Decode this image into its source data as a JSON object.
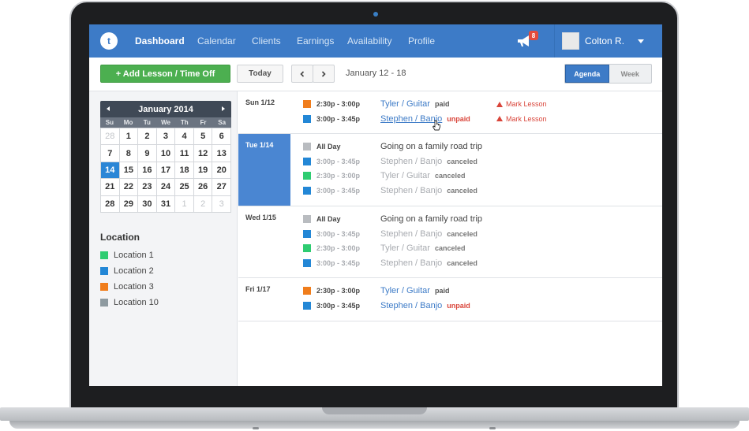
{
  "nav": {
    "logo": "t",
    "items": [
      "Dashboard",
      "Calendar",
      "Clients",
      "Earnings",
      "Availability",
      "Profile"
    ],
    "notification_count": "8",
    "user_name": "Colton R."
  },
  "toolbar": {
    "add_label": "+ Add Lesson / Time Off",
    "today_label": "Today",
    "range_label": "January 12 - 18",
    "view_agenda": "Agenda",
    "view_week": "Week"
  },
  "calendar": {
    "title": "January 2014",
    "dow": [
      "Su",
      "Mo",
      "Tu",
      "We",
      "Th",
      "Fr",
      "Sa"
    ],
    "days": [
      "28",
      "1",
      "2",
      "3",
      "4",
      "5",
      "6",
      "7",
      "8",
      "9",
      "10",
      "11",
      "12",
      "13",
      "12",
      "13",
      "14",
      "15",
      "16",
      "17",
      "18",
      "19",
      "20",
      "21",
      "22",
      "23",
      "24",
      "25",
      "26",
      "27",
      "28",
      "29",
      "30",
      "31",
      "1",
      "2",
      "3"
    ]
  },
  "locations": {
    "title": "Location",
    "items": [
      {
        "label": "Location 1",
        "color": "#2ecc71"
      },
      {
        "label": "Location 2",
        "color": "#2387d6"
      },
      {
        "label": "Location 3",
        "color": "#f07d1c"
      },
      {
        "label": "Location 10",
        "color": "#8e9aa0"
      }
    ]
  },
  "agenda": {
    "mark_lesson": "Mark Lesson",
    "days": [
      {
        "label": "Sun 1/12",
        "rows": [
          {
            "time": "2:30p - 3:00p",
            "student": "Tyler / Guitar",
            "status": "paid",
            "color": "#f07d1c"
          },
          {
            "time": "3:00p - 3:45p",
            "student": "Stephen / Banjo",
            "status": "unpaid",
            "color": "#2387d6"
          }
        ]
      },
      {
        "label": "Tue 1/14",
        "rows": [
          {
            "time": "All Day",
            "student": "Going on a family road trip",
            "status": "",
            "color": "#b9bcc0"
          },
          {
            "time": "3:00p - 3:45p",
            "student": "Stephen / Banjo",
            "status": "canceled",
            "color": "#2387d6"
          },
          {
            "time": "2:30p - 3:00p",
            "student": "Tyler / Guitar",
            "status": "canceled",
            "color": "#2ecc71"
          },
          {
            "time": "3:00p - 3:45p",
            "student": "Stephen / Banjo",
            "status": "canceled",
            "color": "#2387d6"
          }
        ]
      },
      {
        "label": "Wed 1/15",
        "rows": [
          {
            "time": "All Day",
            "student": "Going on a family road trip",
            "status": "",
            "color": "#b9bcc0"
          },
          {
            "time": "3:00p - 3:45p",
            "student": "Stephen / Banjo",
            "status": "canceled",
            "color": "#2387d6"
          },
          {
            "time": "2:30p - 3:00p",
            "student": "Tyler / Guitar",
            "status": "canceled",
            "color": "#2ecc71"
          },
          {
            "time": "3:00p - 3:45p",
            "student": "Stephen / Banjo",
            "status": "canceled",
            "color": "#2387d6"
          }
        ]
      },
      {
        "label": "Fri 1/17",
        "rows": [
          {
            "time": "2:30p - 3:00p",
            "student": "Tyler / Guitar",
            "status": "paid",
            "color": "#f07d1c"
          },
          {
            "time": "3:00p - 3:45p",
            "student": "Stephen / Banjo",
            "status": "unpaid",
            "color": "#2387d6"
          }
        ]
      }
    ]
  }
}
